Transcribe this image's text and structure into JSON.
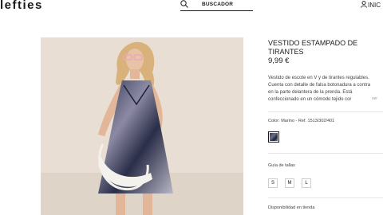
{
  "header": {
    "logo": "lefties",
    "search_label": "BUSCADOR",
    "login_label": "INIC"
  },
  "product": {
    "title": "VESTIDO ESTAMPADO DE TIRANTES",
    "price": "9,99 €",
    "description_lines": [
      "Vestido de escote en V y de tirantes regulables.",
      "Cuenta con detalle de falsa botonadura a contra",
      "en la parte delantera de la prenda. Está",
      "confeccionado en un cómodo tejido cor"
    ],
    "see_more": "ver",
    "color_ref": "Color: Marino - Ref. 1513/302/401",
    "size_guide": "Guía de tallas",
    "sizes": [
      "S",
      "M",
      "L"
    ],
    "availability": "Disponibilidad en tienda"
  }
}
